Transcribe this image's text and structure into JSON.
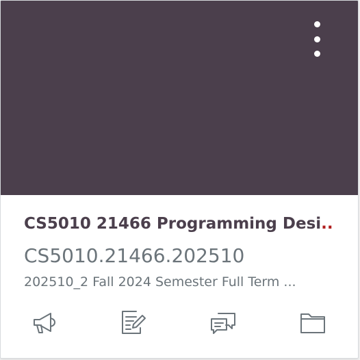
{
  "colors": {
    "hero": "#4b3f4c",
    "title": "#4b3f4c",
    "icon": "#6b747a"
  },
  "card": {
    "title": "CS5010 21466 Programming Desi",
    "title_ellipsis": "...",
    "course_code": "CS5010.21466.202510",
    "term": "202510_2 Fall 2024 Semester Full Term ..."
  },
  "menu": {
    "icon": "more-vertical-icon"
  },
  "actions": [
    {
      "icon": "announcements-icon"
    },
    {
      "icon": "assignments-icon"
    },
    {
      "icon": "discussions-icon"
    },
    {
      "icon": "files-icon"
    }
  ]
}
